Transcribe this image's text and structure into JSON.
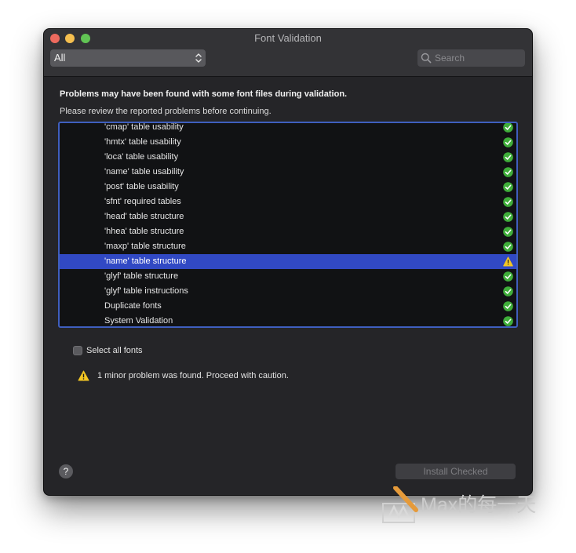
{
  "window": {
    "title": "Font Validation"
  },
  "toolbar": {
    "filter_value": "All",
    "search_placeholder": "Search"
  },
  "message": {
    "heading": "Problems may have been found with some font files during validation.",
    "subheading": "Please review the reported problems before continuing."
  },
  "list": {
    "items": [
      {
        "label": "'cmap' table usability",
        "status": "ok"
      },
      {
        "label": "'hmtx' table usability",
        "status": "ok"
      },
      {
        "label": "'loca' table usability",
        "status": "ok"
      },
      {
        "label": "'name' table usability",
        "status": "ok"
      },
      {
        "label": "'post' table usability",
        "status": "ok"
      },
      {
        "label": "'sfnt' required tables",
        "status": "ok"
      },
      {
        "label": "'head' table structure",
        "status": "ok"
      },
      {
        "label": "'hhea' table structure",
        "status": "ok"
      },
      {
        "label": "'maxp' table structure",
        "status": "ok"
      },
      {
        "label": "'name' table structure",
        "status": "warning",
        "selected": true
      },
      {
        "label": "'glyf' table structure",
        "status": "ok"
      },
      {
        "label": "'glyf' table instructions",
        "status": "ok"
      },
      {
        "label": "Duplicate fonts",
        "status": "ok"
      },
      {
        "label": "System Validation",
        "status": "ok"
      }
    ]
  },
  "select_all": {
    "label": "Select all fonts",
    "checked": false
  },
  "summary": {
    "text": "1 minor problem was found. Proceed with caution."
  },
  "footer": {
    "help_label": "?",
    "install_label": "Install Checked"
  },
  "watermark": {
    "text": "Max的每一天"
  },
  "colors": {
    "ok": "#3fae3a",
    "warning": "#f3c623",
    "selection": "#3149c4",
    "focus_ring": "#3f5fbf"
  }
}
